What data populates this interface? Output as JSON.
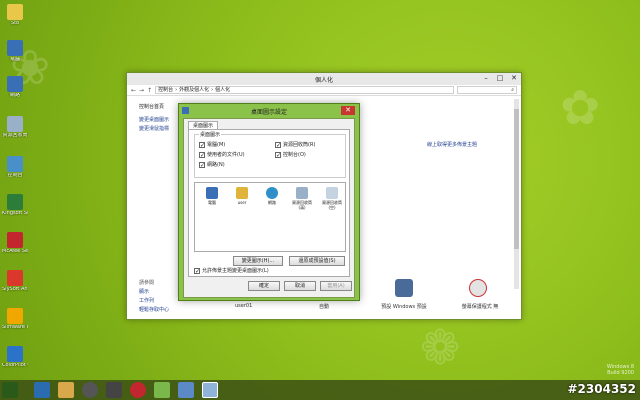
{
  "desktop_icons": [
    {
      "label": "Sto",
      "icon": "folder-icon",
      "color": "#e8c74a"
    },
    {
      "label": "電腦",
      "icon": "computer-icon",
      "color": "#3b6fb5"
    },
    {
      "label": "網路",
      "icon": "network-icon",
      "color": "#3b6fb5"
    },
    {
      "label": "資源回收筒",
      "icon": "recycle-bin-icon",
      "color": "#9ab0c8"
    },
    {
      "label": "控制台",
      "icon": "control-panel-icon",
      "color": "#4a90c8"
    },
    {
      "label": "Kingsoft Support",
      "icon": "app-icon",
      "color": "#2d7d3a"
    },
    {
      "label": "McAfee Security",
      "icon": "mcafee-icon",
      "color": "#c2262e"
    },
    {
      "label": "SlySoft AnyDVD",
      "icon": "app-icon",
      "color": "#d9382b"
    },
    {
      "label": "Slimware Utilities",
      "icon": "app-icon",
      "color": "#f0a800"
    },
    {
      "label": "ColorPilot Clean Player",
      "icon": "app-icon",
      "color": "#2a73c9"
    }
  ],
  "window": {
    "title": "個人化",
    "breadcrumb": [
      "控制台",
      "外觀及個人化",
      "個人化"
    ],
    "left_pane": {
      "title": "控制台首頁",
      "links": [
        "變更桌面圖示",
        "變更滑鼠指標"
      ]
    },
    "see_also": {
      "heading": "請參閱",
      "links": [
        "顯示",
        "工作列",
        "輕鬆存取中心"
      ]
    },
    "right_link": "線上取得更多佈景主題",
    "bottom_items": [
      {
        "label": "user01"
      },
      {
        "label": "自動"
      },
      {
        "label": "預設 Windows 預設"
      },
      {
        "label": "螢幕保護程式 無"
      }
    ]
  },
  "dialog": {
    "title": "桌面圖示設定",
    "tab": "桌面圖示",
    "group_title": "桌面圖示",
    "checkboxes": [
      {
        "label": "電腦(M)",
        "checked": true
      },
      {
        "label": "資源回收筒(R)",
        "checked": true
      },
      {
        "label": "使用者的文件(U)",
        "checked": true
      },
      {
        "label": "控制台(O)",
        "checked": true
      },
      {
        "label": "網路(N)",
        "checked": true
      }
    ],
    "icons": [
      {
        "label": "電腦",
        "icon": "computer-icon"
      },
      {
        "label": "user",
        "icon": "user-folder-icon"
      },
      {
        "label": "網路",
        "icon": "network-icon"
      },
      {
        "label": "資源回收筒(滿)",
        "icon": "recycle-bin-full-icon"
      },
      {
        "label": "資源回收筒(空)",
        "icon": "recycle-bin-empty-icon"
      }
    ],
    "change_icon_button": "變更圖示(H)...",
    "restore_default_button": "還原成預設值(S)",
    "allow_themes_label": "允許佈景主題變更桌面圖示(L)",
    "ok_button": "確定",
    "cancel_button": "取消",
    "apply_button": "套用(A)"
  },
  "taskbar": {
    "os_label": "Windows 8",
    "build_label": "Build 9200"
  },
  "stamp": "#2304352"
}
